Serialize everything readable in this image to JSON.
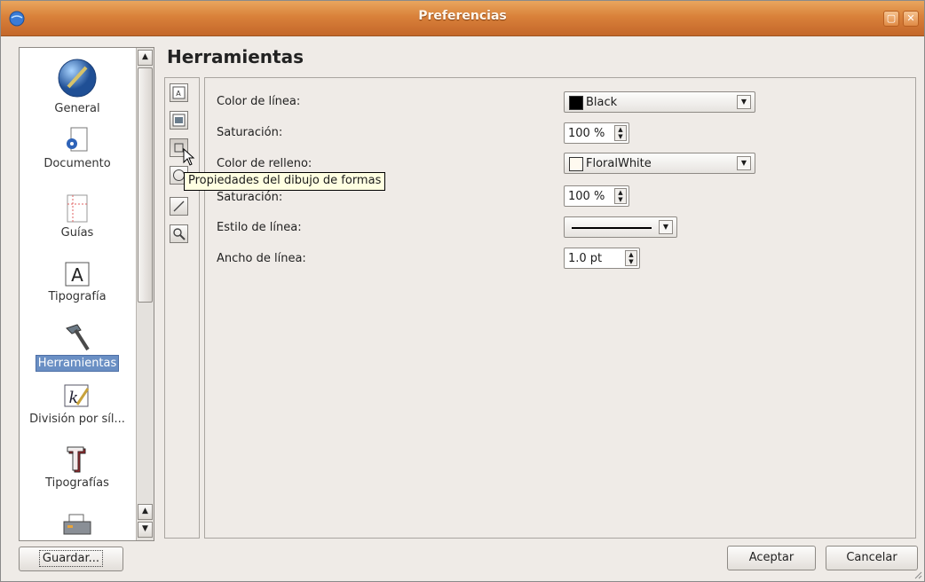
{
  "window": {
    "title": "Preferencias",
    "icon": "app-globe-icon",
    "controls": [
      "maximize-icon",
      "close-icon"
    ],
    "accent_color": "#d9813a"
  },
  "sidebar": {
    "items": [
      {
        "label": "General",
        "icon": "globe-icon",
        "selected": false
      },
      {
        "label": "Documento",
        "icon": "document-icon",
        "selected": false
      },
      {
        "label": "Guías",
        "icon": "guides-icon",
        "selected": false
      },
      {
        "label": "Tipografía",
        "icon": "letter-a-icon",
        "selected": false
      },
      {
        "label": "Herramientas",
        "icon": "hammer-icon",
        "selected": true
      },
      {
        "label": "División por síl...",
        "icon": "hyphenation-icon",
        "selected": false
      },
      {
        "label": "Tipografías",
        "icon": "fonts-icon",
        "selected": false
      },
      {
        "label": "",
        "icon": "printer-icon",
        "selected": false
      }
    ],
    "selected_color": "#6a8fc4"
  },
  "main": {
    "title": "Herramientas",
    "tools": [
      {
        "icon": "text-frame-icon"
      },
      {
        "icon": "image-frame-icon"
      },
      {
        "icon": "shape-icon",
        "active": true
      },
      {
        "icon": "polygon-icon"
      },
      {
        "icon": "line-icon"
      },
      {
        "icon": "zoom-icon"
      }
    ],
    "tooltip": "Propiedades del dibujo de formas",
    "properties": {
      "line_color_label": "Color de línea:",
      "line_color_value": "Black",
      "line_color_hex": "#000000",
      "saturation1_label": "Saturación:",
      "saturation1_value": "100 %",
      "fill_color_label": "Color de relleno:",
      "fill_color_value": "FloralWhite",
      "fill_color_hex": "#fffaf0",
      "saturation2_label": "Saturación:",
      "saturation2_value": "100 %",
      "line_style_label": "Estilo de línea:",
      "line_width_label": "Ancho de línea:",
      "line_width_value": "1.0 pt"
    }
  },
  "footer": {
    "save_label": "Guardar...",
    "accept_label": "Aceptar",
    "cancel_label": "Cancelar"
  }
}
